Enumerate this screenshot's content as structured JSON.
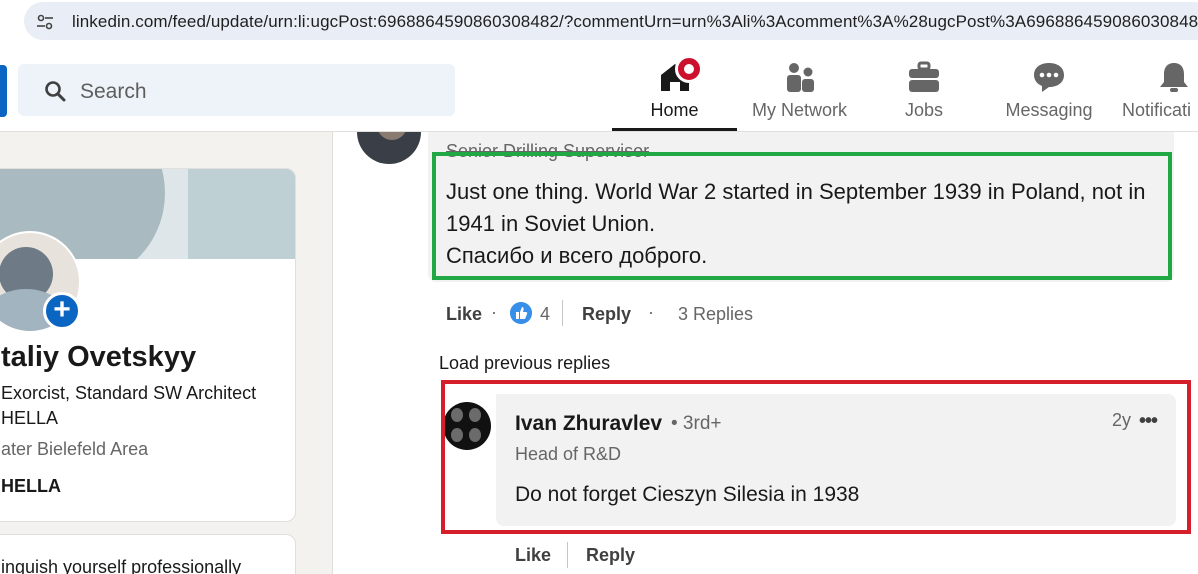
{
  "browser": {
    "url": "linkedin.com/feed/update/urn:li:ugcPost:6968864590860308482/?commentUrn=urn%3Ali%3Acomment%3A%28ugcPost%3A6968864590860308482"
  },
  "header": {
    "search_placeholder": "Search",
    "nav": [
      {
        "label": "Home",
        "icon": "home-icon",
        "active": true
      },
      {
        "label": "My Network",
        "icon": "network-icon"
      },
      {
        "label": "Jobs",
        "icon": "briefcase-icon"
      },
      {
        "label": "Messaging",
        "icon": "messaging-icon"
      },
      {
        "label": "Notificati",
        "icon": "bell-icon"
      }
    ]
  },
  "profile": {
    "name": "taliy Ovetskyy",
    "headline_1": "Exorcist, Standard SW Architect",
    "headline_2": "HELLA",
    "location": "ater Bielefeld Area",
    "company": "HELLA",
    "promo_text": "inguish yourself professionally"
  },
  "comment1": {
    "author_headline": "Senior Drilling Supervisor",
    "text_line_1": "Just one thing. World War 2 started in September 1939 in Poland, not in",
    "text_line_2": "1941 in Soviet Union.",
    "text_line_3": "Спасибо и всего доброго.",
    "like_label": "Like",
    "reaction_count": "4",
    "reply_label": "Reply",
    "replies_label": "3 Replies"
  },
  "load_previous_label": "Load previous replies",
  "comment2": {
    "author_name": "Ivan Zhuravlev",
    "degree": "• 3rd+",
    "time": "2y",
    "more": "•••",
    "headline": "Head of R&D",
    "text": "Do not forget Cieszyn Silesia in 1938",
    "like_label": "Like",
    "reply_label": "Reply"
  },
  "colors": {
    "linkedin_blue": "#0a66c2",
    "highlight_green": "#22a745",
    "highlight_red": "#d51f2b",
    "notification_red": "#cb112d"
  }
}
